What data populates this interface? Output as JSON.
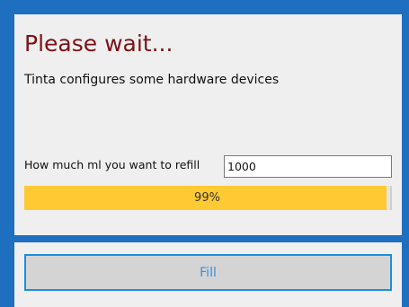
{
  "dialog": {
    "title": "Please wait...",
    "subtitle": "Tinta configures some hardware devices"
  },
  "refill": {
    "label": "How much ml you want to refill",
    "value": "1000"
  },
  "progress": {
    "percent": 99,
    "text": "99%"
  },
  "footer": {
    "fill_label": "Fill"
  },
  "colors": {
    "window_background": "#1e6fc0",
    "title_text": "#7d1216",
    "progress_fill": "#ffc933",
    "button_border": "#1a8ee0",
    "button_text": "#3a8fd6"
  }
}
